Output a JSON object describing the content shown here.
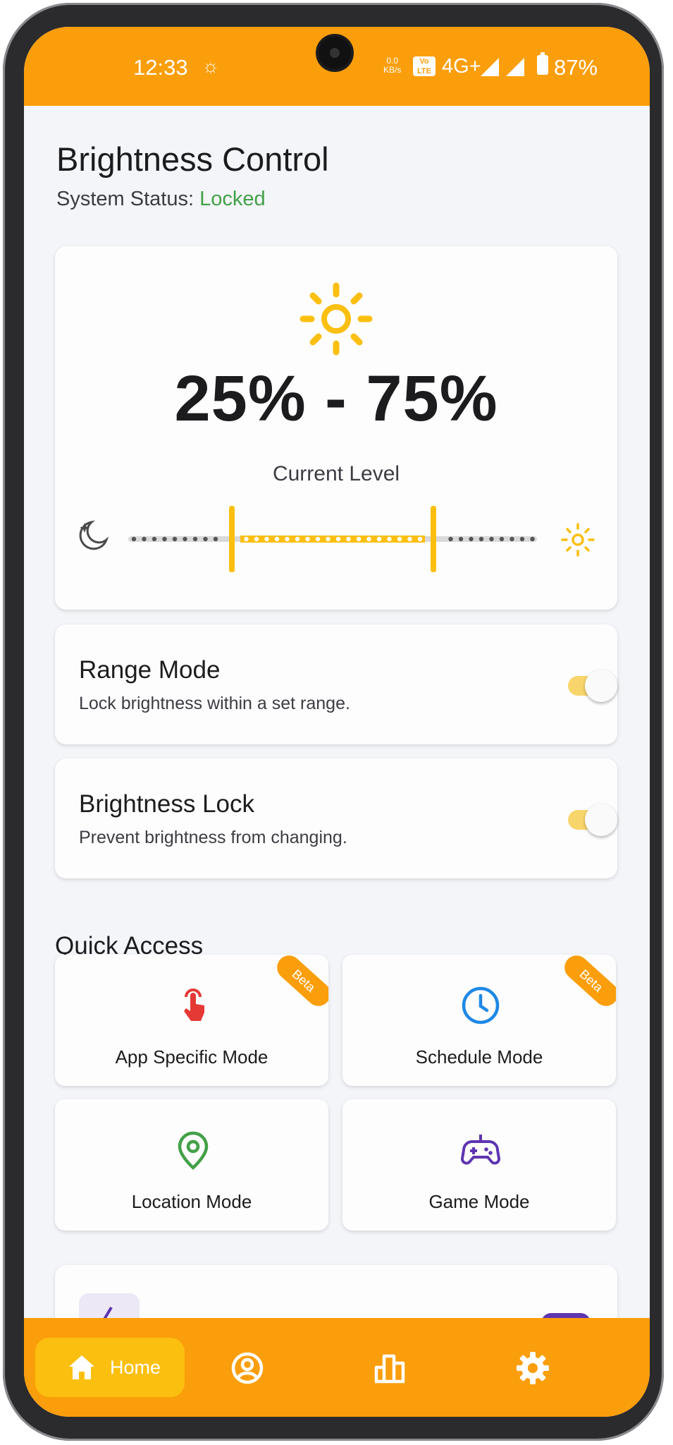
{
  "status_bar": {
    "time": "12:33",
    "net_speed_value": "0.0",
    "net_speed_unit": "KB/s",
    "volte": "Vo LTE",
    "network": "4G+",
    "battery": "87%"
  },
  "header": {
    "title": "Brightness Control",
    "status_label": "System Status:",
    "status_value": "Locked"
  },
  "brightness": {
    "level_text": "25% - 75%",
    "caption": "Current Level",
    "range_min_fraction": 0.25,
    "range_max_fraction": 0.75
  },
  "range_mode": {
    "title": "Range Mode",
    "subtitle": "Lock brightness within a set range.",
    "enabled": true
  },
  "brightness_lock": {
    "title": "Brightness Lock",
    "subtitle": "Prevent brightness from changing.",
    "enabled": true
  },
  "quick_access": {
    "title": "Quick Access",
    "tiles": [
      {
        "label": "App Specific Mode",
        "icon": "tap-hand-icon",
        "badge": "Beta"
      },
      {
        "label": "Schedule Mode",
        "icon": "clock-icon",
        "badge": "Beta"
      },
      {
        "label": "Location Mode",
        "icon": "location-pin-icon"
      },
      {
        "label": "Game Mode",
        "icon": "gamepad-icon"
      }
    ]
  },
  "bottom_nav": {
    "items": [
      {
        "label": "Home",
        "icon": "home-icon",
        "active": true
      },
      {
        "icon": "profile-icon"
      },
      {
        "icon": "stats-icon"
      },
      {
        "icon": "settings-icon"
      }
    ]
  },
  "colors": {
    "accent": "#fb9e0b",
    "sun": "#fbbf10",
    "status_ok": "#43a047",
    "switch_track": "#f8d56b"
  }
}
